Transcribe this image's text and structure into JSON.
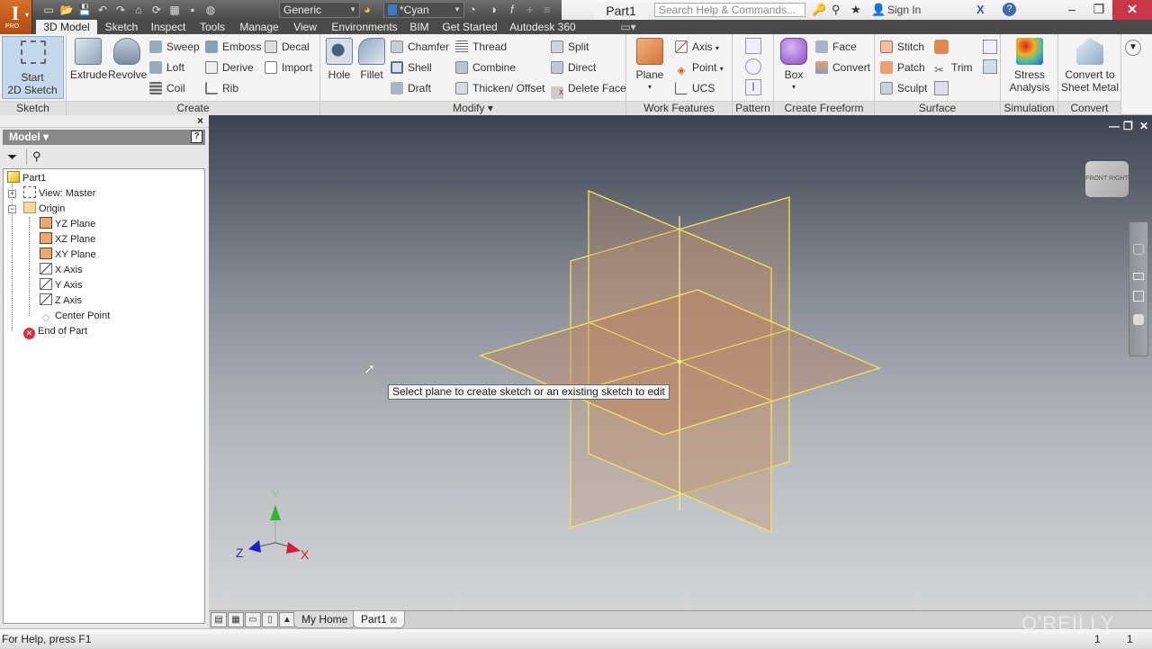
{
  "app": {
    "logo_letter": "I",
    "edition": "PRO",
    "document_title": "Part1"
  },
  "quick_access": {
    "material_combo": "Generic",
    "appearance_combo": "*Cyan",
    "icons": [
      "new-icon",
      "open-icon",
      "save-icon",
      "undo-icon",
      "redo-icon",
      "home-icon",
      "update-icon",
      "select-icon",
      "measure-icon",
      "globe-icon"
    ]
  },
  "help_bar": {
    "search_placeholder": "Search Help & Commands...",
    "sign_in_label": "Sign In",
    "help_icon": "?"
  },
  "window_controls": {
    "minimize": "–",
    "restore": "❐",
    "close": "✕"
  },
  "ribbon_tabs": [
    {
      "label": "3D Model",
      "active": true
    },
    {
      "label": "Sketch"
    },
    {
      "label": "Inspect"
    },
    {
      "label": "Tools"
    },
    {
      "label": "Manage"
    },
    {
      "label": "View"
    },
    {
      "label": "Environments"
    },
    {
      "label": "BIM"
    },
    {
      "label": "Get Started"
    },
    {
      "label": "Autodesk 360"
    }
  ],
  "ribbon": {
    "sketch": {
      "title": "Sketch",
      "start_line1": "Start",
      "start_line2": "2D Sketch"
    },
    "create": {
      "title": "Create",
      "extrude": "Extrude",
      "revolve": "Revolve",
      "sweep": "Sweep",
      "loft": "Loft",
      "coil": "Coil",
      "emboss": "Emboss",
      "derive": "Derive",
      "rib": "Rib",
      "decal": "Decal",
      "import": "Import"
    },
    "modify": {
      "title": "Modify",
      "hole": "Hole",
      "fillet": "Fillet",
      "chamfer": "Chamfer",
      "shell": "Shell",
      "draft": "Draft",
      "thread": "Thread",
      "combine": "Combine",
      "thicken": "Thicken/ Offset",
      "split": "Split",
      "direct": "Direct",
      "delete_face": "Delete Face"
    },
    "work_features": {
      "title": "Work Features",
      "plane": "Plane",
      "axis": "Axis",
      "point": "Point",
      "ucs": "UCS"
    },
    "pattern": {
      "title": "Pattern"
    },
    "create_freeform": {
      "title": "Create Freeform",
      "box": "Box",
      "face": "Face",
      "convert": "Convert"
    },
    "surface": {
      "title": "Surface",
      "stitch": "Stitch",
      "patch": "Patch",
      "sculpt": "Sculpt",
      "trim": "Trim"
    },
    "simulation": {
      "title": "Simulation",
      "stress_line1": "Stress",
      "stress_line2": "Analysis"
    },
    "convert": {
      "title": "Convert",
      "line1": "Convert to",
      "line2": "Sheet Metal"
    }
  },
  "browser": {
    "header": "Model ▾",
    "help": "?",
    "close": "×",
    "tree": [
      {
        "label": "Part1",
        "icon": "part-icon"
      },
      {
        "label": "View: Master",
        "icon": "view-icon"
      },
      {
        "label": "Origin",
        "icon": "folder-icon"
      },
      {
        "label": "YZ Plane",
        "icon": "plane-icon"
      },
      {
        "label": "XZ Plane",
        "icon": "plane-icon"
      },
      {
        "label": "XY Plane",
        "icon": "plane-icon"
      },
      {
        "label": "X Axis",
        "icon": "axis-icon"
      },
      {
        "label": "Y Axis",
        "icon": "axis-icon"
      },
      {
        "label": "Z Axis",
        "icon": "axis-icon"
      },
      {
        "label": "Center Point",
        "icon": "point-icon"
      },
      {
        "label": "End of Part",
        "icon": "end-of-part-icon"
      }
    ]
  },
  "viewport": {
    "tooltip": "Select plane to create sketch or an existing sketch to edit",
    "viewcube_faces": [
      "FRONT",
      "RIGHT"
    ],
    "triad": {
      "x": "X",
      "y": "Y",
      "z": "Z"
    },
    "colors": {
      "plane_edge": "#f2e35a",
      "plane_fill": "#c08a5e",
      "x_axis": "#d0203a",
      "y_axis": "#2fb52f",
      "z_axis": "#2020c0"
    }
  },
  "doc_tabs": {
    "tabs": [
      "My Home",
      "Part1"
    ],
    "active": "Part1",
    "close_glyph": "⊠"
  },
  "status_bar": {
    "help_text": "For Help, press F1",
    "count1": "1",
    "count2": "1"
  },
  "watermark": "O'REILLY"
}
